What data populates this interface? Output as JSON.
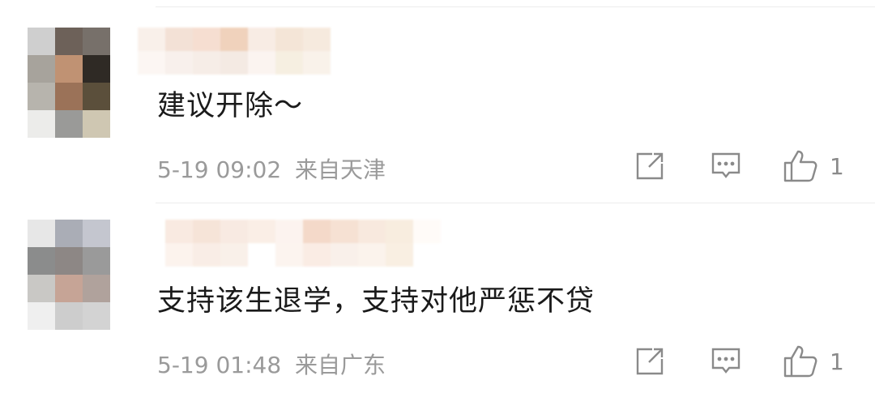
{
  "comments": [
    {
      "text": "建议开除～",
      "date": "5-19 09:02",
      "location": "来自天津",
      "like_count": "1",
      "icons": {
        "share": "share-icon",
        "comment": "comment-icon",
        "like": "thumbs-up-icon"
      }
    },
    {
      "text": "支持该生退学，支持对他严惩不贷",
      "date": "5-19 01:48",
      "location": "来自广东",
      "like_count": "1",
      "icons": {
        "share": "share-icon",
        "comment": "comment-icon",
        "like": "thumbs-up-icon"
      }
    }
  ],
  "colors": {
    "text": "#1a1a1a",
    "meta": "#9a9a9a",
    "icon": "#8a8a8a",
    "divider": "#ececec"
  }
}
